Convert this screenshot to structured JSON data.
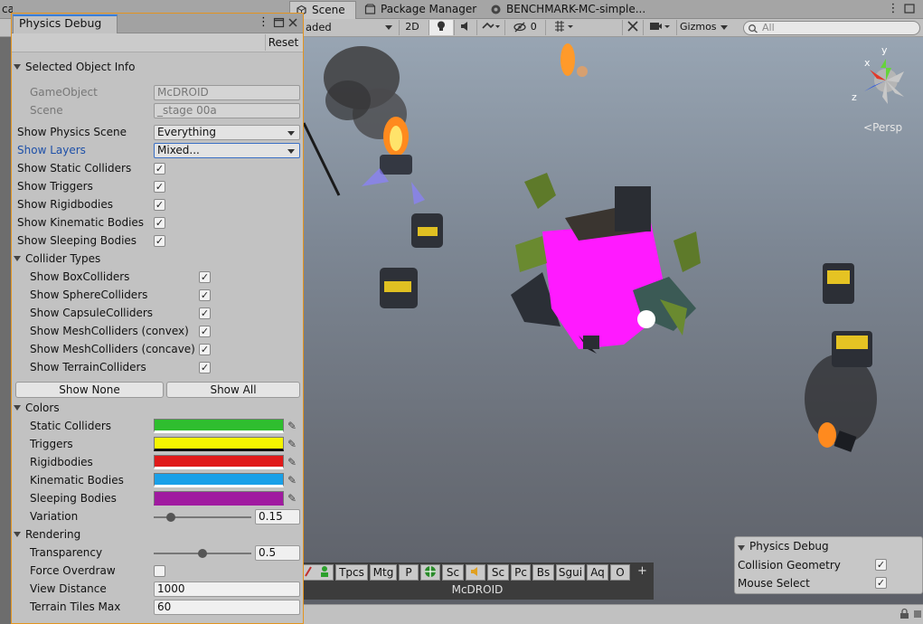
{
  "tabs": {
    "left_cut": "cal",
    "scene": "Scene",
    "package": "Package Manager",
    "bench": "BENCHMARK-MC-simple..."
  },
  "toolbar": {
    "mode": "aded",
    "btn_2d": "2D",
    "fx_count": "0",
    "gizmos": "Gizmos",
    "search_placeholder": "All"
  },
  "gizmo": {
    "y": "y",
    "x": "x",
    "z": "z",
    "persp": "Persp"
  },
  "window": {
    "title": "Physics Debug",
    "reset": "Reset",
    "selected_header": "Selected Object Info",
    "gameobject_label": "GameObject",
    "gameobject_value": "McDROID",
    "scene_label": "Scene",
    "scene_value": "_stage 00a",
    "physics_scene_label": "Show Physics Scene",
    "physics_scene_value": "Everything",
    "layers_label": "Show Layers",
    "layers_value": "Mixed...",
    "toggles": [
      {
        "label": "Show Static Colliders",
        "checked": true
      },
      {
        "label": "Show Triggers",
        "checked": true
      },
      {
        "label": "Show Rigidbodies",
        "checked": true
      },
      {
        "label": "Show Kinematic Bodies",
        "checked": true
      },
      {
        "label": "Show Sleeping Bodies",
        "checked": true
      }
    ],
    "collider_header": "Collider Types",
    "colliders": [
      {
        "label": "Show BoxColliders",
        "checked": true
      },
      {
        "label": "Show SphereColliders",
        "checked": true
      },
      {
        "label": "Show CapsuleColliders",
        "checked": true
      },
      {
        "label": "Show MeshColliders (convex)",
        "checked": true
      },
      {
        "label": "Show MeshColliders (concave)",
        "checked": true
      },
      {
        "label": "Show TerrainColliders",
        "checked": true
      }
    ],
    "show_none": "Show None",
    "show_all": "Show All",
    "colors_header": "Colors",
    "colors": [
      {
        "label": "Static Colliders",
        "color": "#2fbe2f"
      },
      {
        "label": "Triggers",
        "color": "#f5f500"
      },
      {
        "label": "Rigidbodies",
        "color": "#e01a1a"
      },
      {
        "label": "Kinematic Bodies",
        "color": "#1aa0e8"
      },
      {
        "label": "Sleeping Bodies",
        "color": "#a01aa0"
      }
    ],
    "variation_label": "Variation",
    "variation_value": "0.15",
    "rendering_header": "Rendering",
    "transparency_label": "Transparency",
    "transparency_value": "0.5",
    "overdraw_label": "Force Overdraw",
    "overdraw_checked": false,
    "view_distance_label": "View Distance",
    "view_distance_value": "1000",
    "terrain_label": "Terrain Tiles Max",
    "terrain_value": "60"
  },
  "overlay": {
    "title": "Physics Debug",
    "collision_label": "Collision Geometry",
    "mouse_label": "Mouse Select"
  },
  "layerbar": {
    "buttons": [
      "Tpcs",
      "Mtg",
      "P",
      "Sc",
      "Sc",
      "Pc",
      "Bs",
      "Sgui",
      "Aq",
      "O"
    ],
    "plus": "+",
    "name": "McDROID"
  }
}
